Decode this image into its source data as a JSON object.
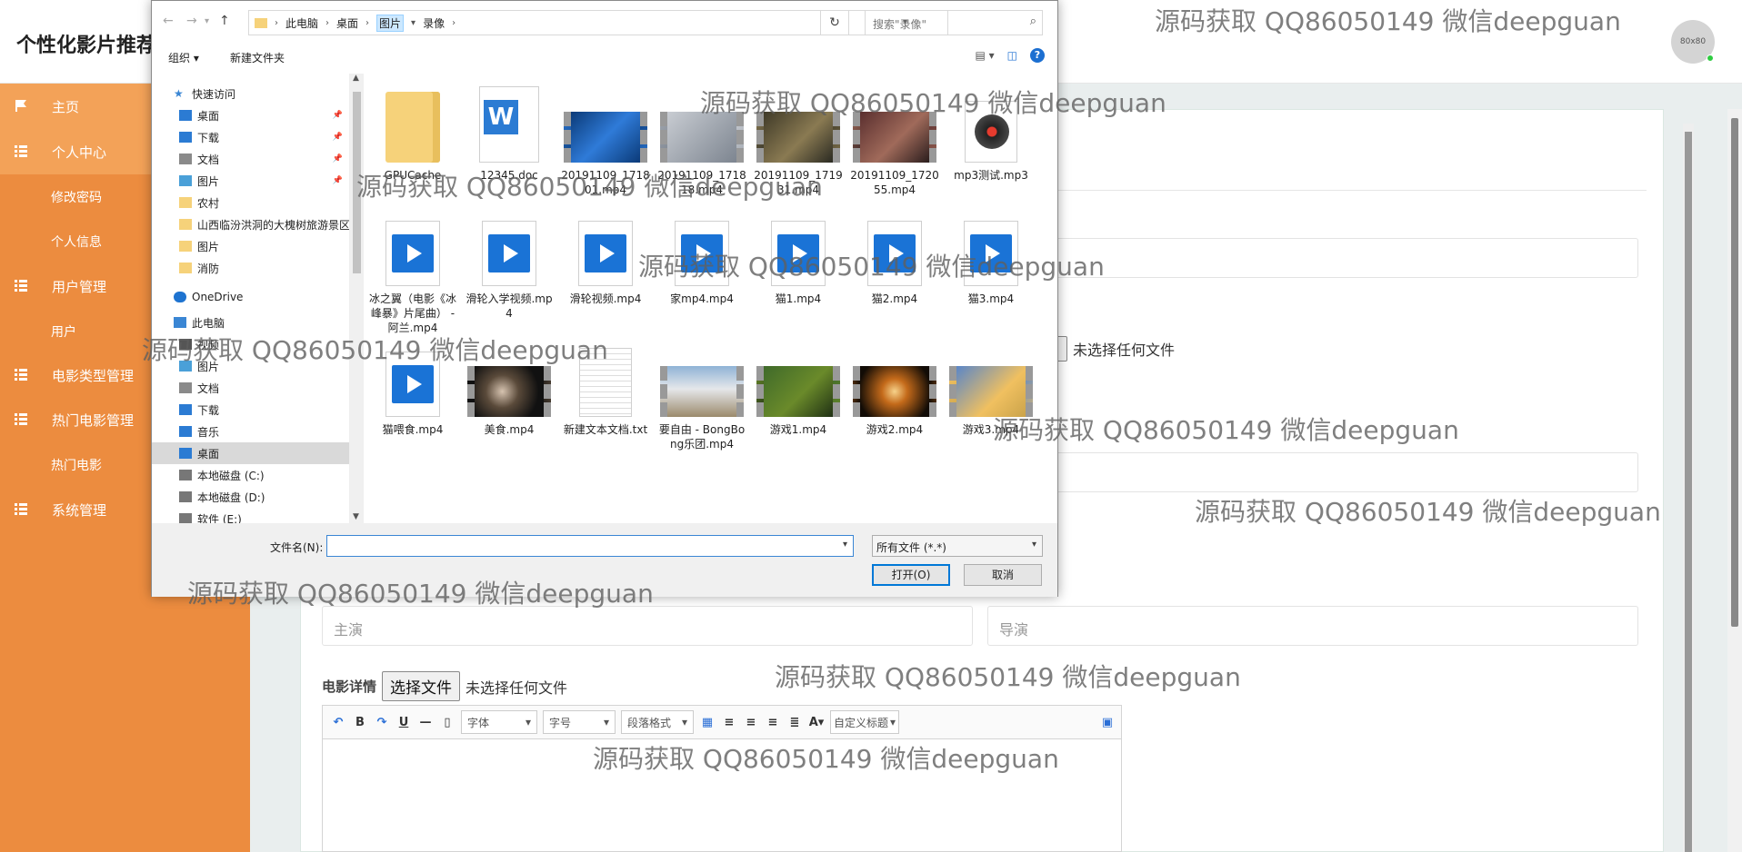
{
  "app": {
    "title": "个性化影片推荐",
    "avatar_text": "80x80"
  },
  "sidebar": {
    "items": [
      {
        "label": "主页",
        "icon": "flag-icon"
      },
      {
        "label": "个人中心",
        "icon": "grid-icon"
      },
      {
        "label": "修改密码"
      },
      {
        "label": "个人信息"
      },
      {
        "label": "用户管理",
        "icon": "grid-icon"
      },
      {
        "label": "用户"
      },
      {
        "label": "电影类型管理",
        "icon": "grid-icon"
      },
      {
        "label": "热门电影管理",
        "icon": "grid-icon"
      },
      {
        "label": "热门电影"
      },
      {
        "label": "系统管理",
        "icon": "grid-icon"
      }
    ],
    "colors": {
      "bg": "#ec8c3f",
      "active": "#f3a258"
    }
  },
  "form": {
    "no_file_text_1": "未选择任何文件",
    "actor_placeholder": "主演",
    "director_placeholder": "导演",
    "detail_label": "电影详情",
    "choose_file_btn": "选择文件",
    "no_file_text_2": "未选择任何文件",
    "editor": {
      "font_select": "字体",
      "size_select": "字号",
      "para_select": "段落格式",
      "custom_title": "自定义标题"
    }
  },
  "dialog": {
    "breadcrumb": [
      "此电脑",
      "桌面",
      "图片",
      "录像"
    ],
    "search_placeholder": "搜索\"录像\"",
    "organize": "组织",
    "new_folder": "新建文件夹",
    "nav_tree": [
      {
        "label": "快速访问",
        "icon": "star-icon"
      },
      {
        "label": "桌面",
        "icon": "desktop-icon",
        "pinned": true
      },
      {
        "label": "下载",
        "icon": "download-icon",
        "pinned": true
      },
      {
        "label": "文档",
        "icon": "document-icon",
        "pinned": true
      },
      {
        "label": "图片",
        "icon": "picture-icon",
        "pinned": true
      },
      {
        "label": "农村",
        "icon": "folder-icon"
      },
      {
        "label": "山西临汾洪洞的大槐树旅游景区",
        "icon": "folder-icon"
      },
      {
        "label": "图片",
        "icon": "folder-icon"
      },
      {
        "label": "消防",
        "icon": "folder-icon"
      },
      {
        "label": "OneDrive",
        "icon": "cloud-icon"
      },
      {
        "label": "此电脑",
        "icon": "computer-icon"
      },
      {
        "label": "视频",
        "icon": "video-icon"
      },
      {
        "label": "图片",
        "icon": "picture-icon"
      },
      {
        "label": "文档",
        "icon": "document-icon"
      },
      {
        "label": "下载",
        "icon": "download-icon"
      },
      {
        "label": "音乐",
        "icon": "music-icon"
      },
      {
        "label": "桌面",
        "icon": "desktop-icon"
      },
      {
        "label": "本地磁盘 (C:)",
        "icon": "drive-icon"
      },
      {
        "label": "本地磁盘 (D:)",
        "icon": "drive-icon"
      },
      {
        "label": "软件 (E:)",
        "icon": "drive-icon"
      }
    ],
    "files": [
      {
        "name": "GPUCache",
        "kind": "folder"
      },
      {
        "name": "12345.doc",
        "kind": "doc"
      },
      {
        "name": "20191109_171801.mp4",
        "kind": "video",
        "variant": "v1"
      },
      {
        "name": "20191109_171818.mp4",
        "kind": "video",
        "variant": "v2"
      },
      {
        "name": "20191109_171931.mp4",
        "kind": "video",
        "variant": "v3"
      },
      {
        "name": "20191109_172055.mp4",
        "kind": "video",
        "variant": "v4"
      },
      {
        "name": "mp3测试.mp3",
        "kind": "mp3"
      },
      {
        "name": "冰之翼（电影《冰峰暴》片尾曲） - 阿兰.mp4",
        "kind": "play"
      },
      {
        "name": "滑轮入学视频.mp4",
        "kind": "play"
      },
      {
        "name": "滑轮视频.mp4",
        "kind": "play"
      },
      {
        "name": "家mp4.mp4",
        "kind": "play"
      },
      {
        "name": "猫1.mp4",
        "kind": "play"
      },
      {
        "name": "猫2.mp4",
        "kind": "play"
      },
      {
        "name": "猫3.mp4",
        "kind": "play"
      },
      {
        "name": "猫喂食.mp4",
        "kind": "play"
      },
      {
        "name": "美食.mp4",
        "kind": "video",
        "variant": "v5"
      },
      {
        "name": "新建文本文档.txt",
        "kind": "txt"
      },
      {
        "name": "要自由 - BongBong乐团.mp4",
        "kind": "video",
        "variant": "v6"
      },
      {
        "name": "游戏1.mp4",
        "kind": "video",
        "variant": "v7"
      },
      {
        "name": "游戏2.mp4",
        "kind": "video",
        "variant": "v8"
      },
      {
        "name": "游戏3.mp4",
        "kind": "video",
        "variant": "v9"
      }
    ],
    "filename_label": "文件名(N):",
    "filename_value": "",
    "filter_value": "所有文件 (*.*)",
    "open_btn": "打开(O)",
    "cancel_btn": "取消"
  },
  "watermark_text": "源码获取 QQ86050149 微信deepguan"
}
